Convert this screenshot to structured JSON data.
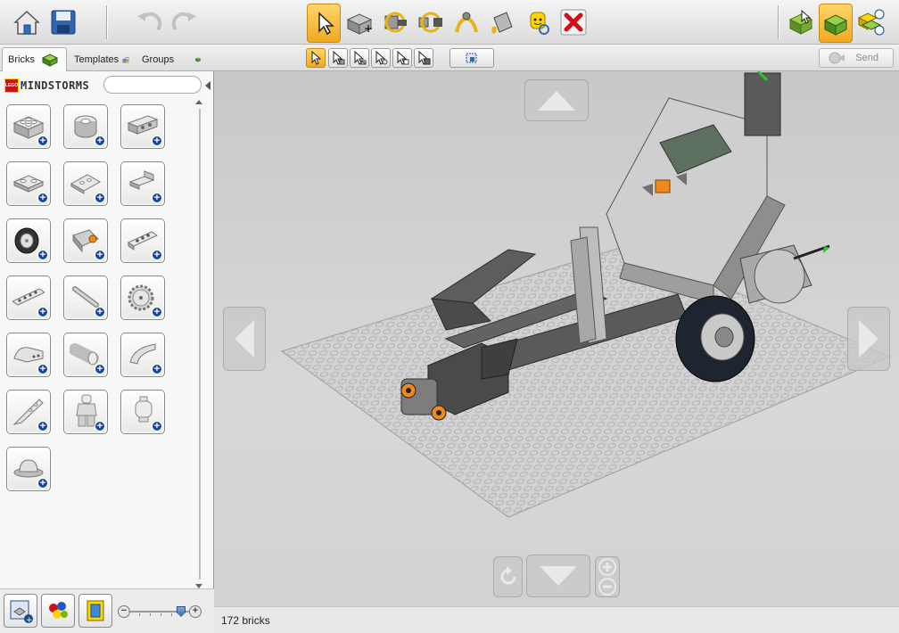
{
  "toolbar": {
    "buttons": [
      {
        "name": "home-button",
        "icon": "home-icon"
      },
      {
        "name": "save-button",
        "icon": "save-icon"
      },
      {
        "name": "undo-button",
        "icon": "undo-icon",
        "enabled": false
      },
      {
        "name": "redo-button",
        "icon": "redo-icon",
        "enabled": false
      },
      {
        "name": "select-tool-button",
        "icon": "cursor-icon",
        "active": true
      },
      {
        "name": "clone-tool-button",
        "icon": "clone-brick-icon"
      },
      {
        "name": "hinge-tool-button",
        "icon": "hinge-icon"
      },
      {
        "name": "hinge-align-tool-button",
        "icon": "hinge-align-icon"
      },
      {
        "name": "flex-tool-button",
        "icon": "flex-icon"
      },
      {
        "name": "paint-tool-button",
        "icon": "paint-bucket-icon"
      },
      {
        "name": "hide-tool-button",
        "icon": "minifig-icon"
      },
      {
        "name": "delete-tool-button",
        "icon": "delete-x-icon"
      }
    ],
    "mode_buttons": [
      {
        "name": "build-mode-button",
        "icon": "build-mode-icon"
      },
      {
        "name": "view-mode-button",
        "icon": "view-mode-icon",
        "active": true
      },
      {
        "name": "building-guide-mode-button",
        "icon": "building-guide-icon"
      }
    ],
    "colors": {
      "active": "#f0a920",
      "delete": "#d01012",
      "lego_yellow": "#ffd500",
      "lego_green": "#7ab800"
    }
  },
  "tabs": [
    {
      "label": "Bricks",
      "icon": "brick-green-icon",
      "active": true
    },
    {
      "label": "Templates",
      "icon": "templates-icon",
      "active": false
    },
    {
      "label": "Groups",
      "icon": "groups-icon",
      "active": false
    }
  ],
  "selection_tools": [
    {
      "name": "single-select-button",
      "icon": "cursor-single-icon",
      "active": true
    },
    {
      "name": "connected-select-button",
      "icon": "cursor-connected-icon"
    },
    {
      "name": "color-select-button",
      "icon": "cursor-color-icon"
    },
    {
      "name": "shape-select-button",
      "icon": "cursor-shape-icon"
    },
    {
      "name": "color-shape-select-button",
      "icon": "cursor-color-shape-icon"
    },
    {
      "name": "invert-select-button",
      "icon": "cursor-invert-icon"
    },
    {
      "name": "group-select-button",
      "icon": "cursor-group-icon"
    }
  ],
  "send": {
    "label": "Send",
    "enabled": false
  },
  "brand": {
    "logo_text": "LEGO",
    "word": "MINDSTORMS"
  },
  "search": {
    "value": "",
    "placeholder": ""
  },
  "palette": {
    "bricks": [
      {
        "name": "brick-2x2"
      },
      {
        "name": "round-brick"
      },
      {
        "name": "technic-brick"
      },
      {
        "name": "plate-2x2"
      },
      {
        "name": "wedge-plate"
      },
      {
        "name": "bracket-plate"
      },
      {
        "name": "wheel"
      },
      {
        "name": "motor"
      },
      {
        "name": "technic-beam-short"
      },
      {
        "name": "technic-beam-long"
      },
      {
        "name": "axle"
      },
      {
        "name": "gear"
      },
      {
        "name": "curved-panel"
      },
      {
        "name": "cylinder"
      },
      {
        "name": "curved-slope"
      },
      {
        "name": "wing-plate"
      },
      {
        "name": "minifigure"
      },
      {
        "name": "minifig-head"
      },
      {
        "name": "hat"
      }
    ]
  },
  "status": {
    "brick_count": "172 bricks"
  }
}
